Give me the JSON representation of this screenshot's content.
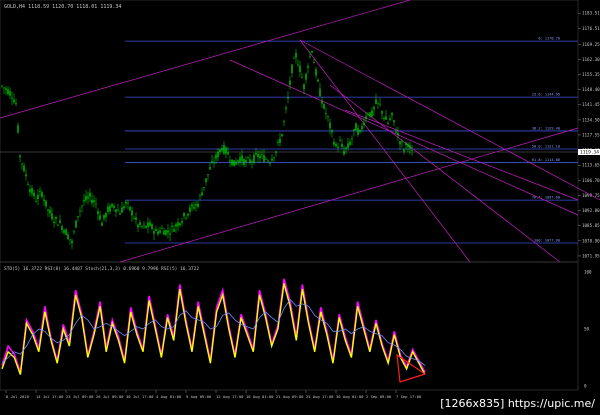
{
  "window": {
    "title": "GOLD,H4 1118.59 1120.70 1118.01 1119.34"
  },
  "indicator_header": "STO(5) 16.3722  RSI(8) 16.4487  Stoch(21,3,3) 0.6960 9.7996  RSI(5) 16.3722",
  "current_price_label": "1119.34",
  "badge": "[1266x835] https://upic.me/",
  "colors": {
    "background": "#000000",
    "candles": "#00cc00",
    "fib_lines": "#3b4fd8",
    "channel_lines": "#c020c0",
    "rsi_yellow": "#ffff00",
    "rsi_magenta": "#ff00ff",
    "stoch_blue": "#6a8cff",
    "triangle_red": "#ff2020",
    "text": "#c8c8c8"
  },
  "fib_levels": [
    {
      "label": "0: 1170.70",
      "price": 1170.7
    },
    {
      "label": "23.6: 1144.95",
      "price": 1144.95
    },
    {
      "label": "38.2: 1129.40",
      "price": 1129.4
    },
    {
      "label": "50.0: 1121.10",
      "price": 1121.1
    },
    {
      "label": "61.8: 1114.86",
      "price": 1114.86
    },
    {
      "label": "76.4: 1097.60",
      "price": 1097.6
    },
    {
      "label": "100: 1077.90",
      "price": 1077.9
    }
  ],
  "chart_data": [
    {
      "type": "candlestick",
      "symbol": "GOLD",
      "timeframe": "H4",
      "ohlc_last": {
        "open": 1118.59,
        "high": 1120.7,
        "low": 1118.01,
        "close": 1119.34
      },
      "ylim": [
        1071.0,
        1185.0
      ],
      "y_ticks": [
        1183.51,
        1176.51,
        1169.25,
        1162.3,
        1155.35,
        1148.4,
        1141.45,
        1134.5,
        1127.55,
        1120.6,
        1113.65,
        1106.7,
        1099.75,
        1092.8,
        1085.85,
        1078.9,
        1071.95
      ],
      "close_path": [
        {
          "x": 0,
          "y": 1150
        },
        {
          "x": 6,
          "y": 1148
        },
        {
          "x": 10,
          "y": 1146
        },
        {
          "x": 14,
          "y": 1142
        },
        {
          "x": 18,
          "y": 1118
        },
        {
          "x": 22,
          "y": 1112
        },
        {
          "x": 28,
          "y": 1103
        },
        {
          "x": 34,
          "y": 1098
        },
        {
          "x": 40,
          "y": 1101
        },
        {
          "x": 46,
          "y": 1093
        },
        {
          "x": 52,
          "y": 1089
        },
        {
          "x": 58,
          "y": 1087
        },
        {
          "x": 64,
          "y": 1083
        },
        {
          "x": 70,
          "y": 1078
        },
        {
          "x": 76,
          "y": 1091
        },
        {
          "x": 82,
          "y": 1097
        },
        {
          "x": 88,
          "y": 1099
        },
        {
          "x": 94,
          "y": 1096
        },
        {
          "x": 100,
          "y": 1087
        },
        {
          "x": 106,
          "y": 1093
        },
        {
          "x": 112,
          "y": 1095
        },
        {
          "x": 118,
          "y": 1092
        },
        {
          "x": 124,
          "y": 1096
        },
        {
          "x": 130,
          "y": 1092
        },
        {
          "x": 136,
          "y": 1086
        },
        {
          "x": 142,
          "y": 1085
        },
        {
          "x": 148,
          "y": 1086
        },
        {
          "x": 154,
          "y": 1083
        },
        {
          "x": 160,
          "y": 1084
        },
        {
          "x": 166,
          "y": 1083
        },
        {
          "x": 172,
          "y": 1085
        },
        {
          "x": 178,
          "y": 1088
        },
        {
          "x": 184,
          "y": 1091
        },
        {
          "x": 190,
          "y": 1094
        },
        {
          "x": 196,
          "y": 1096
        },
        {
          "x": 202,
          "y": 1104
        },
        {
          "x": 208,
          "y": 1112
        },
        {
          "x": 214,
          "y": 1117
        },
        {
          "x": 220,
          "y": 1122
        },
        {
          "x": 226,
          "y": 1119
        },
        {
          "x": 232,
          "y": 1114
        },
        {
          "x": 238,
          "y": 1117
        },
        {
          "x": 244,
          "y": 1115
        },
        {
          "x": 250,
          "y": 1116
        },
        {
          "x": 256,
          "y": 1118
        },
        {
          "x": 262,
          "y": 1117
        },
        {
          "x": 268,
          "y": 1116
        },
        {
          "x": 274,
          "y": 1120
        },
        {
          "x": 280,
          "y": 1128
        },
        {
          "x": 286,
          "y": 1144
        },
        {
          "x": 290,
          "y": 1158
        },
        {
          "x": 294,
          "y": 1164
        },
        {
          "x": 298,
          "y": 1158
        },
        {
          "x": 302,
          "y": 1150
        },
        {
          "x": 306,
          "y": 1160
        },
        {
          "x": 310,
          "y": 1167
        },
        {
          "x": 314,
          "y": 1156
        },
        {
          "x": 318,
          "y": 1147
        },
        {
          "x": 322,
          "y": 1140
        },
        {
          "x": 326,
          "y": 1135
        },
        {
          "x": 330,
          "y": 1128
        },
        {
          "x": 334,
          "y": 1122
        },
        {
          "x": 338,
          "y": 1124
        },
        {
          "x": 342,
          "y": 1120
        },
        {
          "x": 346,
          "y": 1122
        },
        {
          "x": 350,
          "y": 1126
        },
        {
          "x": 354,
          "y": 1131
        },
        {
          "x": 358,
          "y": 1128
        },
        {
          "x": 362,
          "y": 1134
        },
        {
          "x": 366,
          "y": 1138
        },
        {
          "x": 370,
          "y": 1137
        },
        {
          "x": 374,
          "y": 1142
        },
        {
          "x": 378,
          "y": 1141
        },
        {
          "x": 382,
          "y": 1136
        },
        {
          "x": 386,
          "y": 1133
        },
        {
          "x": 390,
          "y": 1136
        },
        {
          "x": 394,
          "y": 1130
        },
        {
          "x": 398,
          "y": 1125
        },
        {
          "x": 402,
          "y": 1121
        },
        {
          "x": 406,
          "y": 1124
        },
        {
          "x": 410,
          "y": 1119
        }
      ]
    },
    {
      "type": "line",
      "title": "STO(5) / RSI(8) / Stoch(21,3,3) / RSI(5)",
      "ylim": [
        0,
        100
      ],
      "y_ticks": [
        100,
        50,
        0
      ],
      "x_ticks": [
        "8 Jul 2010",
        "14 Jul 17:00",
        "23 Jul 09:00",
        "26 Jul 09:00",
        "30 Jul 17:00",
        "4 Aug 01:00",
        "9 Aug 09:00",
        "12 Aug 17:00",
        "18 Aug 01:00",
        "21 Aug 09:00",
        "25 Aug 17:00",
        "30 Aug 01:00",
        "2 Sep 09:00",
        "7 Sep 17:00"
      ],
      "series": [
        {
          "name": "RSI(8)",
          "color": "#ffff00",
          "values": [
            15,
            30,
            25,
            10,
            55,
            45,
            30,
            65,
            40,
            20,
            50,
            35,
            80,
            60,
            25,
            45,
            70,
            30,
            55,
            40,
            20,
            65,
            45,
            30,
            75,
            50,
            25,
            60,
            40,
            85,
            55,
            30,
            70,
            45,
            20,
            65,
            80,
            50,
            25,
            60,
            45,
            30,
            80,
            60,
            35,
            50,
            90,
            70,
            40,
            85,
            55,
            30,
            65,
            45,
            20,
            60,
            40,
            25,
            70,
            50,
            30,
            55,
            35,
            20,
            45,
            25,
            15,
            30,
            20,
            10
          ]
        },
        {
          "name": "RSI(5)",
          "color": "#ff00ff",
          "values": [
            18,
            35,
            28,
            12,
            58,
            48,
            33,
            70,
            42,
            22,
            54,
            38,
            84,
            63,
            27,
            48,
            74,
            33,
            58,
            43,
            22,
            69,
            48,
            32,
            79,
            53,
            27,
            63,
            43,
            89,
            58,
            32,
            74,
            48,
            22,
            69,
            84,
            53,
            27,
            63,
            48,
            32,
            84,
            63,
            37,
            53,
            94,
            74,
            43,
            89,
            58,
            32,
            69,
            48,
            22,
            63,
            43,
            27,
            74,
            53,
            32,
            58,
            37,
            22,
            48,
            27,
            17,
            32,
            22,
            12
          ]
        },
        {
          "name": "Stoch(21,3,3)",
          "color": "#6a8cff",
          "values": [
            20,
            25,
            30,
            28,
            35,
            45,
            50,
            48,
            42,
            38,
            40,
            45,
            55,
            62,
            58,
            50,
            52,
            55,
            52,
            48,
            44,
            48,
            52,
            50,
            55,
            58,
            52,
            50,
            52,
            62,
            66,
            60,
            58,
            56,
            50,
            52,
            62,
            64,
            58,
            54,
            52,
            50,
            60,
            65,
            60,
            56,
            68,
            76,
            70,
            72,
            70,
            62,
            58,
            55,
            48,
            48,
            50,
            46,
            50,
            52,
            48,
            46,
            44,
            38,
            36,
            32,
            26,
            24,
            22,
            18
          ]
        }
      ],
      "annotation": "red triangle drawn near recent lows"
    }
  ]
}
